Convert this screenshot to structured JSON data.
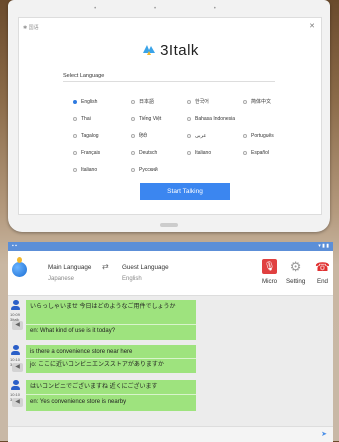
{
  "tablet": {
    "top_text": "✱ 国语",
    "app_name": "3Italk",
    "select_label": "Select Language",
    "languages": [
      {
        "label": "English",
        "selected": true
      },
      {
        "label": "日本語",
        "selected": false
      },
      {
        "label": "한국어",
        "selected": false
      },
      {
        "label": "简体中文",
        "selected": false
      },
      {
        "label": "Thai",
        "selected": false
      },
      {
        "label": "Tiếng Việt",
        "selected": false
      },
      {
        "label": "Bahasa Indonesia",
        "selected": false
      },
      {
        "label": "",
        "selected": false
      },
      {
        "label": "Tagalog",
        "selected": false
      },
      {
        "label": "हिंदी",
        "selected": false
      },
      {
        "label": "عربى",
        "selected": false
      },
      {
        "label": "Português",
        "selected": false
      },
      {
        "label": "Français",
        "selected": false
      },
      {
        "label": "Deutsch",
        "selected": false
      },
      {
        "label": "Italiano",
        "selected": false
      },
      {
        "label": "Español",
        "selected": false
      },
      {
        "label": "Italiano",
        "selected": false
      },
      {
        "label": "Pyccкий",
        "selected": false
      },
      {
        "label": "",
        "selected": false
      },
      {
        "label": "",
        "selected": false
      }
    ],
    "start_button": "Start Talking"
  },
  "phone": {
    "main_language_label": "Main Language",
    "main_language_value": "Japanese",
    "guest_language_label": "Guest Language",
    "guest_language_value": "English",
    "controls": {
      "micro": "Micro",
      "setting": "Setting",
      "end": "End"
    },
    "messages": [
      {
        "time": "10:09\n3italk",
        "original": "いらっしゃいませ 今日はどのようなご用件でしょうか",
        "translated": "en: What kind of use is it today?"
      },
      {
        "time": "10:10\n3italk",
        "original": "is there a convenience store near here",
        "translated": "jo: ここに近いコンビニエンスストアがありますか"
      },
      {
        "time": "10:10\n3italk",
        "original": "はいコンビニでございますね 近くにございます",
        "translated": "en: Yes convenience store is nearby"
      }
    ]
  },
  "colors": {
    "accent": "#3b86f0",
    "bubble": "#9ee37e",
    "status_bar": "#5c8fd8",
    "end_red": "#e03030"
  }
}
